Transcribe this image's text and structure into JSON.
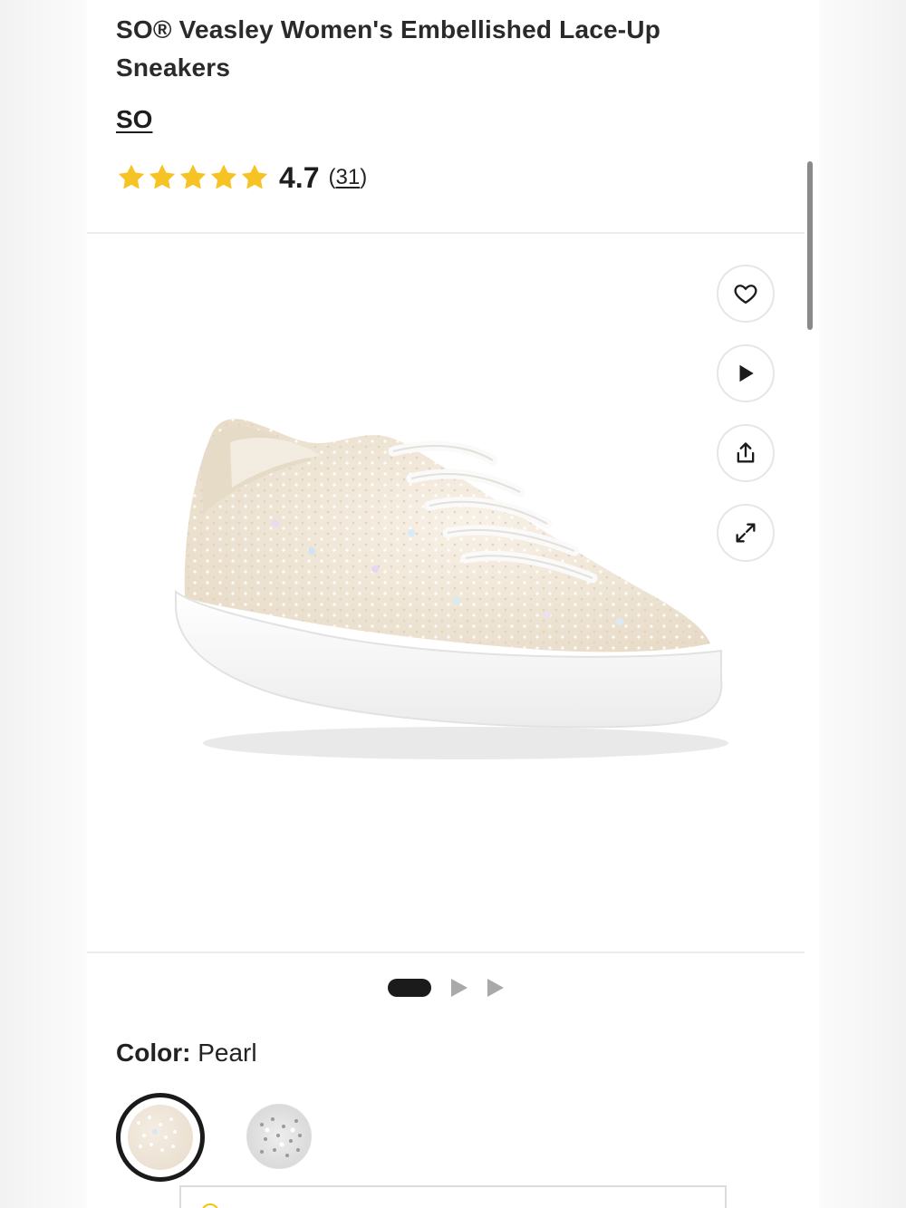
{
  "product": {
    "title": "SO® Veasley Women's Embellished Lace-Up Sneakers",
    "brand": "SO",
    "rating": {
      "stars": 5,
      "star_color": "#F7C324",
      "value": "4.7",
      "count_open": "(",
      "count": "31",
      "count_close": ")"
    }
  },
  "media": {
    "image_alt": "Pearl embellished white lace-up platform sneaker",
    "actions": [
      {
        "icon": "heart-icon"
      },
      {
        "icon": "play-icon"
      },
      {
        "icon": "share-icon"
      },
      {
        "icon": "expand-icon"
      }
    ],
    "carousel": {
      "total": 3,
      "active_index": 0
    }
  },
  "color": {
    "label": "Color:",
    "selected": "Pearl",
    "swatches": [
      {
        "name": "Pearl",
        "selected": true
      },
      {
        "name": "Silver rhinestone",
        "selected": false
      }
    ]
  }
}
